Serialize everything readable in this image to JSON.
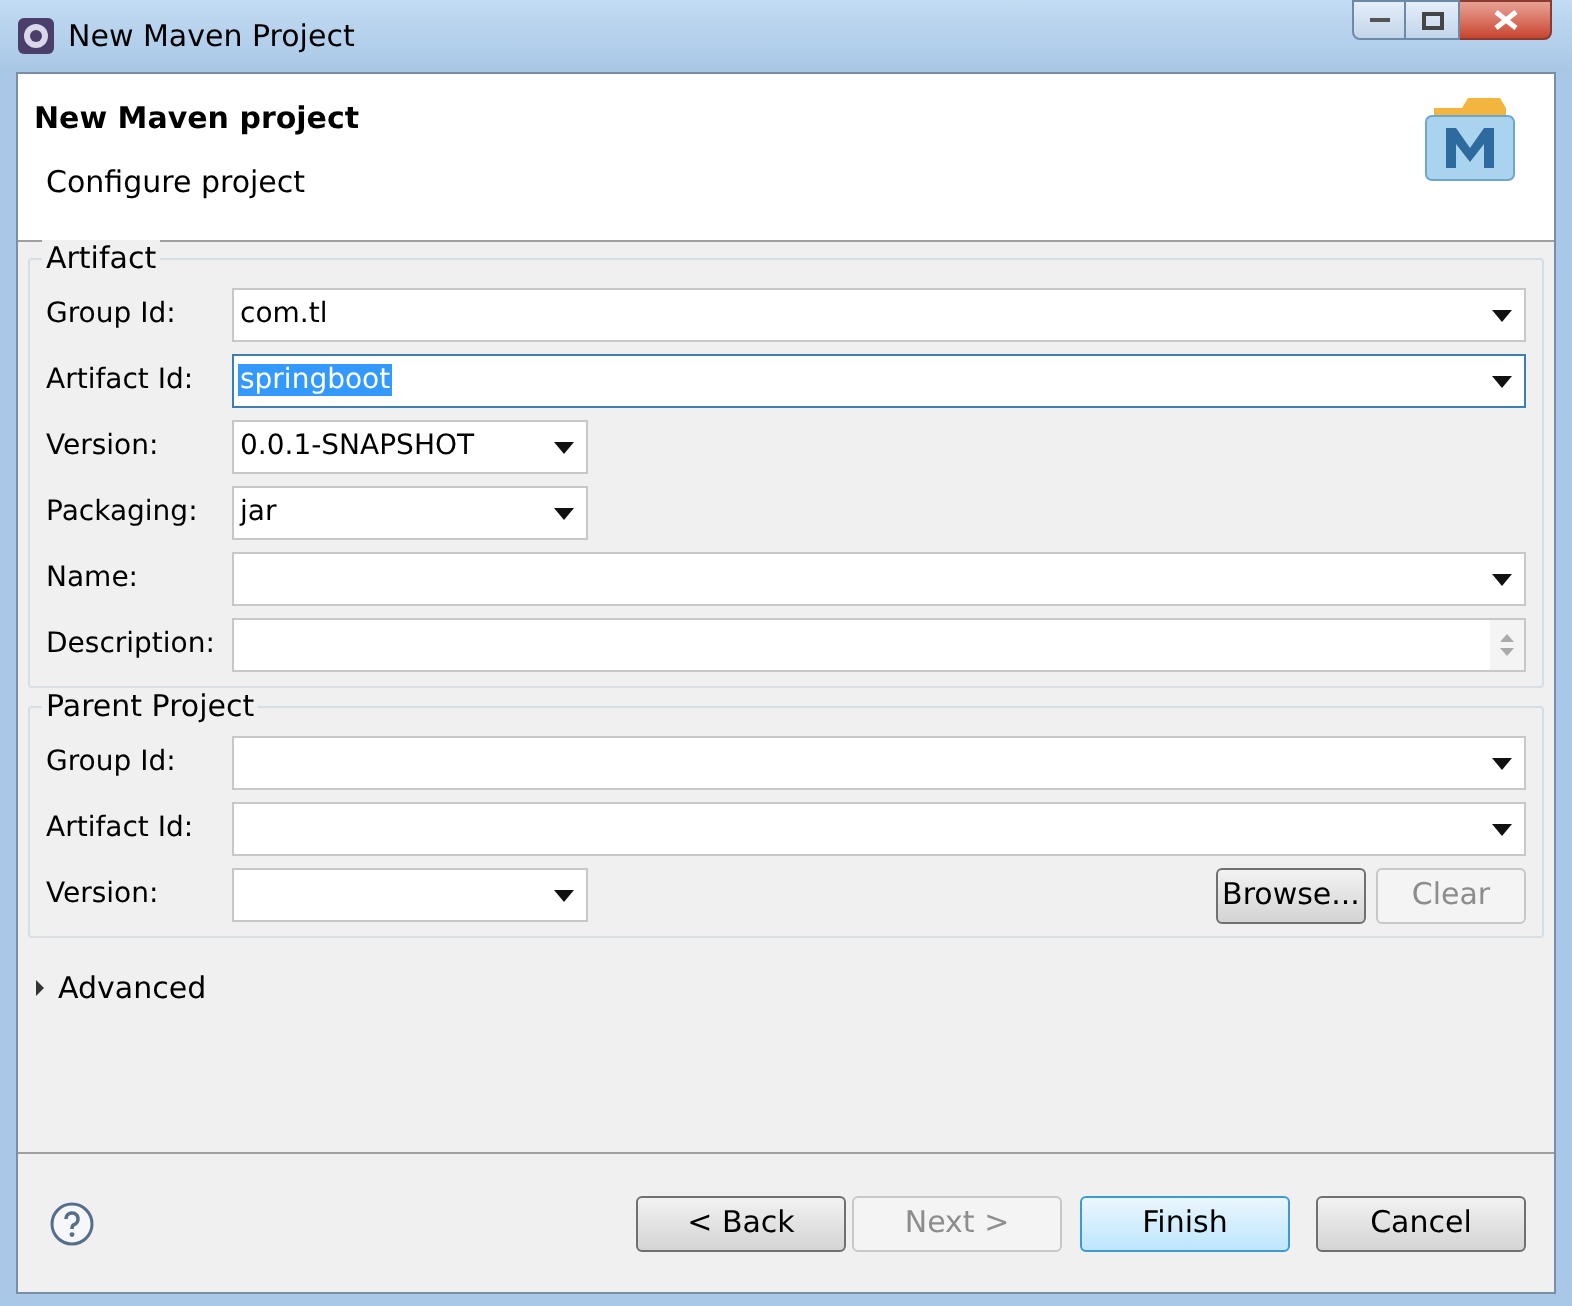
{
  "window": {
    "title": "New Maven Project"
  },
  "header": {
    "title": "New Maven project",
    "subtitle": "Configure project"
  },
  "artifact": {
    "legend": "Artifact",
    "fields": [
      {
        "label": "Group Id:",
        "value": "com.tl",
        "kind": "combo",
        "selected": false
      },
      {
        "label": "Artifact Id:",
        "value": "springboot",
        "kind": "combo",
        "selected": true
      },
      {
        "label": "Version:",
        "value": "0.0.1-SNAPSHOT",
        "kind": "short-combo",
        "selected": false
      },
      {
        "label": "Packaging:",
        "value": "jar",
        "kind": "short-combo",
        "selected": false
      },
      {
        "label": "Name:",
        "kind": "combo",
        "selected": false
      },
      {
        "label": "Description:",
        "kind": "textarea",
        "selected": false
      }
    ]
  },
  "parent": {
    "legend": "Parent Project",
    "fields": [
      {
        "label": "Group Id:",
        "kind": "combo",
        "selected": false
      },
      {
        "label": "Artifact Id:",
        "kind": "combo",
        "selected": false
      },
      {
        "label": "Version:",
        "kind": "short-combo",
        "selected": false
      }
    ],
    "buttons": [
      {
        "label": "Browse...",
        "disabled": false
      },
      {
        "label": "Clear",
        "disabled": true
      }
    ]
  },
  "advanced": {
    "label": "Advanced",
    "expanded": false
  },
  "buttons": [
    {
      "label": "< Back",
      "disabled": false
    },
    {
      "label": "Next >",
      "disabled": true
    },
    {
      "label": "Finish",
      "disabled": false,
      "default": true
    },
    {
      "label": "Cancel",
      "disabled": false
    }
  ]
}
